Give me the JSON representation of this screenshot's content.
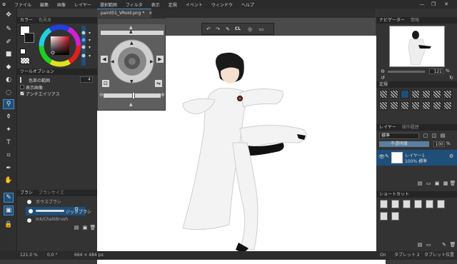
{
  "menu": [
    "ファイル",
    "編集",
    "画像",
    "レイヤー",
    "選択範囲",
    "フィルタ",
    "表示",
    "定規",
    "イベント",
    "ウィンドウ",
    "ヘルプ"
  ],
  "window_controls": {
    "minimize": "—",
    "maximize": "❐",
    "close": "✕"
  },
  "document_tab": {
    "title": "paint01_VRoid.png *",
    "close": "×"
  },
  "color_panel": {
    "tab_color": "カラー",
    "tab_palette": "色見本",
    "foreground": "#ffffff",
    "background": "#1a1a1a"
  },
  "tool_options": {
    "title": "ツールオプション",
    "range_label": "色差の範囲",
    "range_value": "4",
    "show_image": "表示画像",
    "antialias": "アンチエイリアス"
  },
  "brush_panel": {
    "tab_brush": "ブラシ",
    "tab_size": "ブラシサイズ",
    "items": [
      "ガウスブラシ",
      "ジッタブラシ",
      "Ink/ChalkBrush"
    ]
  },
  "nav_panel": {
    "tab_nav": "ナビゲーター",
    "tab_info": "情報",
    "zoom": "121",
    "unit": "%"
  },
  "ruler_panel": {
    "title": "定規"
  },
  "layer_panel": {
    "tab_layer": "レイヤー",
    "tab_history": "操作履歴",
    "blend": "標準",
    "opacity_label": "不透明度",
    "opacity": "100",
    "unit": "%",
    "layer_name": "レイヤー1",
    "layer_desc": "100% 標準"
  },
  "shortcut_panel": {
    "title": "ショートカット"
  },
  "status": {
    "zoom": "121.0 %",
    "angle": "0.0 °",
    "size": "664 × 484 px",
    "mode": "On",
    "tablet": "タブレット 2",
    "tablet_state": "タブレット位置"
  },
  "float_toolbar": {
    "cl": "CL"
  }
}
